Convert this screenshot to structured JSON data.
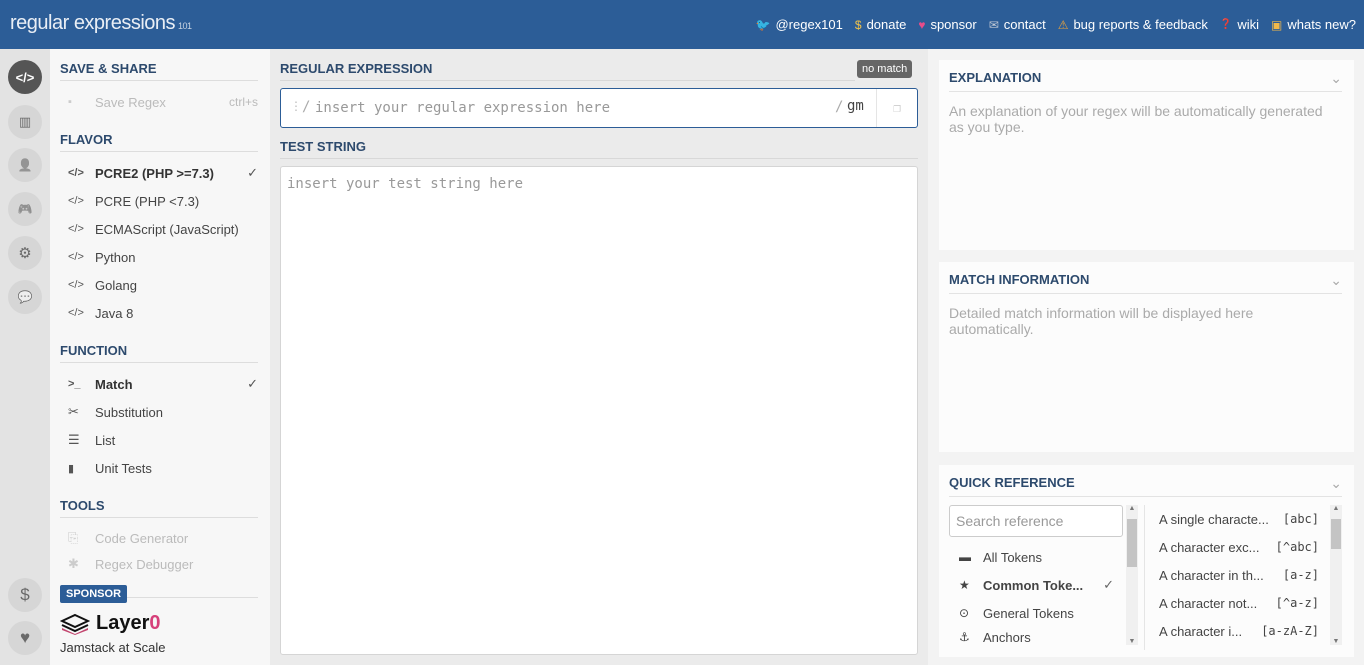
{
  "header": {
    "logo": "regular expressions",
    "logo_sup": "101",
    "links": [
      {
        "icon": "twitter-icon",
        "glyph": "🐦",
        "label": "@regex101",
        "color": "#4da3e8"
      },
      {
        "icon": "dollar-icon",
        "glyph": "$",
        "label": "donate",
        "color": "#f0c24a"
      },
      {
        "icon": "heart-icon",
        "glyph": "♥",
        "label": "sponsor",
        "color": "#e74c8a"
      },
      {
        "icon": "envelope-icon",
        "glyph": "✉",
        "label": "contact",
        "color": "#c0c8d4"
      },
      {
        "icon": "warning-icon",
        "glyph": "⚠",
        "label": "bug reports & feedback",
        "color": "#e9a23b"
      },
      {
        "icon": "wiki-icon",
        "glyph": "❓",
        "label": "wiki",
        "color": "#6fb3f0"
      },
      {
        "icon": "news-icon",
        "glyph": "▣",
        "label": "whats new?",
        "color": "#f0b84a"
      }
    ]
  },
  "rail": {
    "top": [
      {
        "name": "editor",
        "glyph": "</>",
        "active": true
      },
      {
        "name": "library",
        "glyph": "▥"
      },
      {
        "name": "account",
        "glyph": "👤"
      },
      {
        "name": "quiz",
        "glyph": "🎮"
      },
      {
        "name": "settings",
        "glyph": "⚙"
      },
      {
        "name": "chat",
        "glyph": "💬"
      }
    ],
    "bottom": [
      {
        "name": "donate",
        "glyph": "$"
      },
      {
        "name": "sponsor",
        "glyph": "♥"
      }
    ]
  },
  "sidebar": {
    "save_share": {
      "title": "SAVE & SHARE",
      "save_label": "Save Regex",
      "save_shortcut": "ctrl+s"
    },
    "flavor": {
      "title": "FLAVOR",
      "items": [
        {
          "label": "PCRE2 (PHP >=7.3)",
          "selected": true
        },
        {
          "label": "PCRE (PHP <7.3)"
        },
        {
          "label": "ECMAScript (JavaScript)"
        },
        {
          "label": "Python"
        },
        {
          "label": "Golang"
        },
        {
          "label": "Java 8"
        }
      ]
    },
    "function": {
      "title": "FUNCTION",
      "items": [
        {
          "label": "Match",
          "glyph": ">_",
          "selected": true
        },
        {
          "label": "Substitution",
          "glyph": "✂"
        },
        {
          "label": "List",
          "glyph": "☰"
        },
        {
          "label": "Unit Tests",
          "glyph": "▮"
        }
      ]
    },
    "tools": {
      "title": "TOOLS",
      "items": [
        {
          "label": "Code Generator",
          "glyph": "⎘"
        },
        {
          "label": "Regex Debugger",
          "glyph": "✱"
        }
      ]
    },
    "sponsor": {
      "badge": "SPONSOR",
      "brand": "Layer",
      "brand_suffix": "0",
      "tagline": "Jamstack at Scale"
    }
  },
  "main": {
    "regex_title": "REGULAR EXPRESSION",
    "match_status": "no match",
    "regex_value": "",
    "regex_placeholder": "insert your regular expression here",
    "delimiter": "/",
    "flags": "gm",
    "test_title": "TEST STRING",
    "test_value": "",
    "test_placeholder": "insert your test string here"
  },
  "right": {
    "explanation": {
      "title": "EXPLANATION",
      "text": "An explanation of your regex will be automatically generated as you type."
    },
    "match_info": {
      "title": "MATCH INFORMATION",
      "text": "Detailed match information will be displayed here automatically."
    },
    "quick_ref": {
      "title": "QUICK REFERENCE",
      "search_placeholder": "Search reference",
      "categories": [
        {
          "label": "All Tokens",
          "glyph": "▬"
        },
        {
          "label": "Common Toke...",
          "glyph": "★",
          "selected": true
        },
        {
          "label": "General Tokens",
          "glyph": "⊙"
        },
        {
          "label": "Anchors",
          "glyph": "⚓"
        }
      ],
      "tokens": [
        {
          "desc": "A single characte...",
          "code": "[abc]"
        },
        {
          "desc": "A character exc...",
          "code": "[^abc]"
        },
        {
          "desc": "A character in th...",
          "code": "[a-z]"
        },
        {
          "desc": "A character not...",
          "code": "[^a-z]"
        },
        {
          "desc": "A character i...",
          "code": "[a-zA-Z]"
        }
      ]
    }
  }
}
